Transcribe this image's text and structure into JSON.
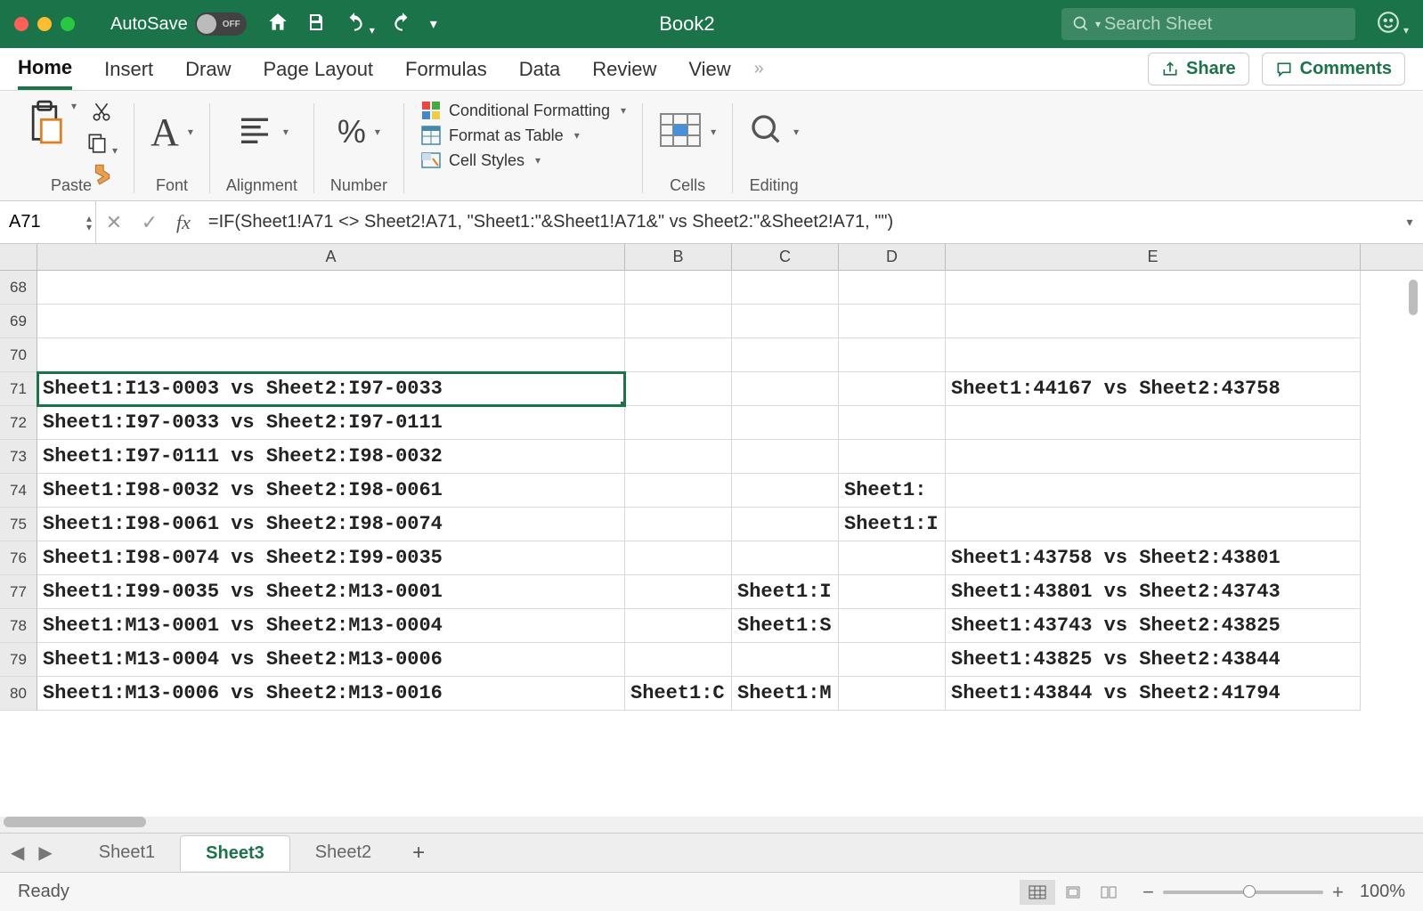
{
  "titlebar": {
    "autosave_label": "AutoSave",
    "toggle_state": "OFF",
    "document_title": "Book2",
    "search_placeholder": "Search Sheet"
  },
  "ribbon_tabs": [
    "Home",
    "Insert",
    "Draw",
    "Page Layout",
    "Formulas",
    "Data",
    "Review",
    "View"
  ],
  "ribbon_tabs_active": "Home",
  "actions": {
    "share": "Share",
    "comments": "Comments"
  },
  "ribbon_groups": {
    "paste": "Paste",
    "font": "Font",
    "alignment": "Alignment",
    "number": "Number",
    "cond_format": "Conditional Formatting",
    "format_table": "Format as Table",
    "cell_styles": "Cell Styles",
    "cells": "Cells",
    "editing": "Editing"
  },
  "formula_bar": {
    "name_box": "A71",
    "formula": "=IF(Sheet1!A71 <> Sheet2!A71, \"Sheet1:\"&Sheet1!A71&\" vs Sheet2:\"&Sheet2!A71, \"\")"
  },
  "columns": [
    "A",
    "B",
    "C",
    "D",
    "E"
  ],
  "rows": [
    {
      "r": 68,
      "A": "",
      "B": "",
      "C": "",
      "D": "",
      "E": ""
    },
    {
      "r": 69,
      "A": "",
      "B": "",
      "C": "",
      "D": "",
      "E": ""
    },
    {
      "r": 70,
      "A": "",
      "B": "",
      "C": "",
      "D": "",
      "E": ""
    },
    {
      "r": 71,
      "A": "Sheet1:I13-0003 vs Sheet2:I97-0033",
      "B": "",
      "C": "",
      "D": "",
      "E": "Sheet1:44167 vs Sheet2:43758"
    },
    {
      "r": 72,
      "A": "Sheet1:I97-0033 vs Sheet2:I97-0111",
      "B": "",
      "C": "",
      "D": "",
      "E": ""
    },
    {
      "r": 73,
      "A": "Sheet1:I97-0111 vs Sheet2:I98-0032",
      "B": "",
      "C": "",
      "D": "",
      "E": ""
    },
    {
      "r": 74,
      "A": "Sheet1:I98-0032 vs Sheet2:I98-0061",
      "B": "",
      "C": "",
      "D": "Sheet1:",
      "E": ""
    },
    {
      "r": 75,
      "A": "Sheet1:I98-0061 vs Sheet2:I98-0074",
      "B": "",
      "C": "",
      "D": "Sheet1:I",
      "E": ""
    },
    {
      "r": 76,
      "A": "Sheet1:I98-0074 vs Sheet2:I99-0035",
      "B": "",
      "C": "",
      "D": "",
      "E": "Sheet1:43758 vs Sheet2:43801"
    },
    {
      "r": 77,
      "A": "Sheet1:I99-0035 vs Sheet2:M13-0001",
      "B": "",
      "C": "Sheet1:I",
      "D": "",
      "E": "Sheet1:43801 vs Sheet2:43743"
    },
    {
      "r": 78,
      "A": "Sheet1:M13-0001 vs Sheet2:M13-0004",
      "B": "",
      "C": "Sheet1:S",
      "D": "",
      "E": "Sheet1:43743 vs Sheet2:43825"
    },
    {
      "r": 79,
      "A": "Sheet1:M13-0004 vs Sheet2:M13-0006",
      "B": "",
      "C": "",
      "D": "",
      "E": "Sheet1:43825 vs Sheet2:43844"
    },
    {
      "r": 80,
      "A": "Sheet1:M13-0006 vs Sheet2:M13-0016",
      "B": "Sheet1:C",
      "C": "Sheet1:M",
      "D": "",
      "E": "Sheet1:43844 vs Sheet2:41794"
    }
  ],
  "selected_row": 71,
  "sheet_tabs": [
    "Sheet1",
    "Sheet3",
    "Sheet2"
  ],
  "sheet_tabs_active": "Sheet3",
  "status": {
    "ready": "Ready",
    "zoom": "100%"
  }
}
